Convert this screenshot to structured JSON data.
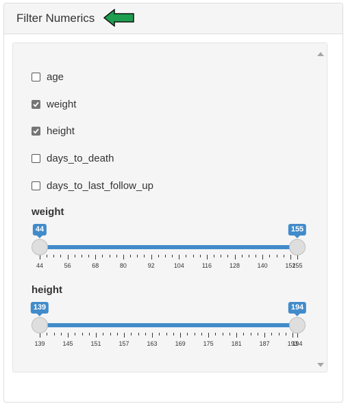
{
  "panel": {
    "title": "Filter Numerics"
  },
  "checkboxes": [
    {
      "label": "age",
      "checked": false
    },
    {
      "label": "weight",
      "checked": true
    },
    {
      "label": "height",
      "checked": true
    },
    {
      "label": "days_to_death",
      "checked": false
    },
    {
      "label": "days_to_last_follow_up",
      "checked": false
    }
  ],
  "sliders": [
    {
      "title": "weight",
      "min": 44,
      "max": 155,
      "from": 44,
      "to": 155,
      "ticks": [
        "44",
        "56",
        "68",
        "80",
        "92",
        "104",
        "116",
        "128",
        "140",
        "152",
        "155"
      ]
    },
    {
      "title": "height",
      "min": 139,
      "max": 194,
      "from": 139,
      "to": 194,
      "ticks": [
        "139",
        "145",
        "151",
        "157",
        "163",
        "169",
        "175",
        "181",
        "187",
        "193",
        "194"
      ]
    }
  ],
  "colors": {
    "accent": "#428bca",
    "arrow": "#1e9e4e"
  }
}
